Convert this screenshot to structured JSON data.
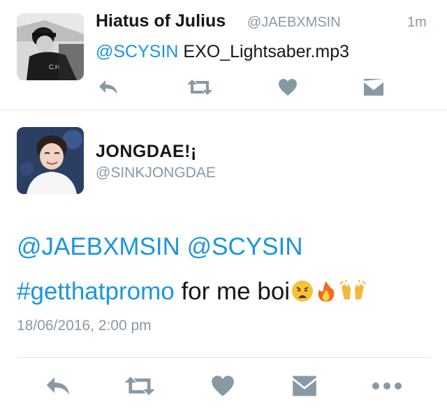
{
  "tweet1": {
    "display_name": "Hiatus of Julius",
    "handle": "@JAEBXMSIN",
    "time": "1m",
    "mention": "@SCYSIN",
    "text": " EXO_Lightsaber.mp3",
    "avatar_icon": "user-avatar-photo"
  },
  "tweet2": {
    "display_name": "JONGDAE!¡",
    "handle": "@SINKJONGDAE",
    "mention1": "@JAEBXMSIN",
    "mention2": "@SCYSIN",
    "hashtag": "#getthatpromo",
    "text": " for me boi",
    "emojis": [
      "weary-face-icon",
      "fire-icon",
      "open-hands-icon"
    ],
    "date": "18/06/2016, 2:00 pm",
    "avatar_icon": "user-avatar-photo"
  },
  "actions": [
    "reply-icon",
    "retweet-icon",
    "like-icon",
    "direct-message-icon",
    "more-icon"
  ],
  "colors": {
    "link": "#1b95e0",
    "icon": "#8899a6",
    "text": "#14171a",
    "divider": "#e1e8ed"
  }
}
